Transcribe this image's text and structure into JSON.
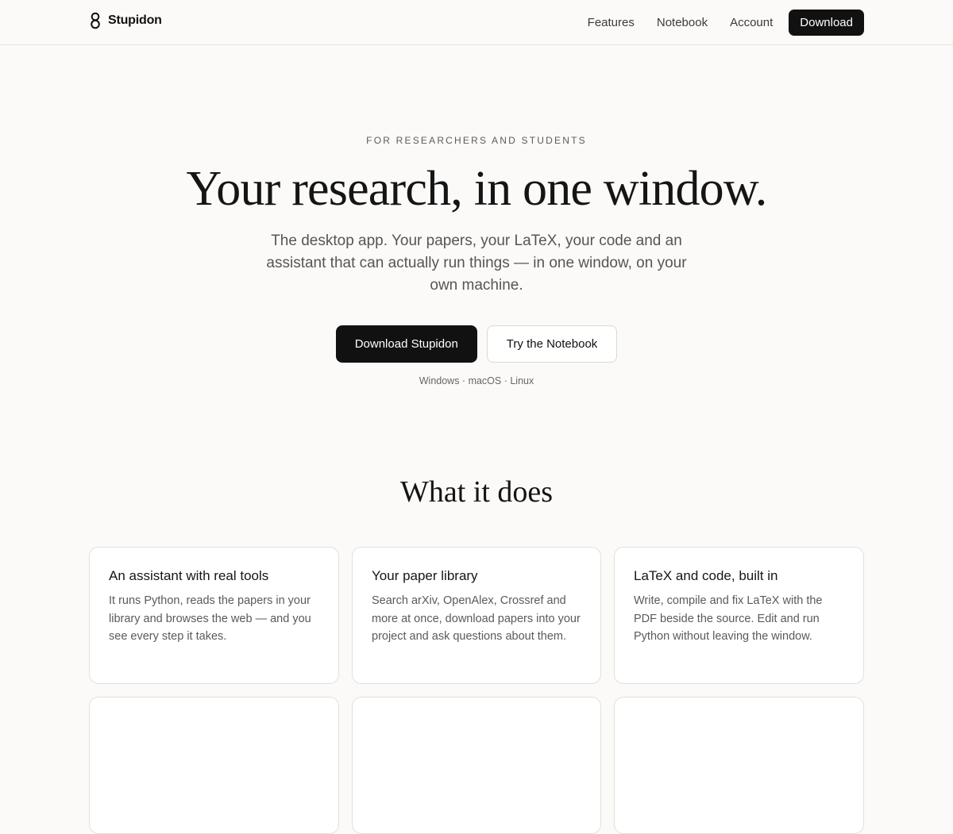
{
  "header": {
    "brand": "Stupidon",
    "nav": [
      "Features",
      "Notebook",
      "Account"
    ],
    "cta": "Download"
  },
  "hero": {
    "eyebrow": "FOR RESEARCHERS AND STUDENTS",
    "title": "Your research, in one window.",
    "subtitle": "The desktop app. Your papers, your LaTeX, your code and an assistant that can actually run things — in one window, on your own machine.",
    "primary_cta": "Download Stupidon",
    "secondary_cta": "Try the Notebook",
    "platforms": "Windows · macOS · Linux"
  },
  "features": {
    "title": "What it does",
    "cards": [
      {
        "title": "An assistant with real tools",
        "body": "It runs Python, reads the papers in your library and browses the web — and you see every step it takes."
      },
      {
        "title": "Your paper library",
        "body": "Search arXiv, OpenAlex, Crossref and more at once, download papers into your project and ask questions about them."
      },
      {
        "title": "LaTeX and code, built in",
        "body": "Write, compile and fix LaTeX with the PDF beside the source. Edit and run Python without leaving the window."
      },
      {
        "title": "",
        "body": ""
      },
      {
        "title": "",
        "body": ""
      },
      {
        "title": "",
        "body": ""
      }
    ]
  },
  "colors": {
    "background": "#fbfaf8",
    "primary": "#111111",
    "border": "#e3e0db"
  },
  "icons": {
    "brand": "stupidon-logo-icon"
  }
}
